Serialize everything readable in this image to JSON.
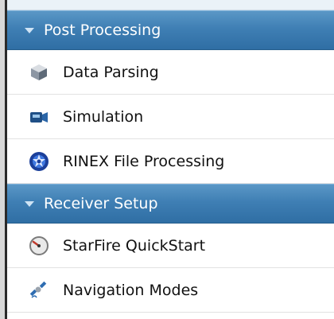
{
  "sections": [
    {
      "title": "Post Processing",
      "items": [
        {
          "label": "Data Parsing",
          "icon": "cube-icon"
        },
        {
          "label": "Simulation",
          "icon": "video-camera-icon"
        },
        {
          "label": "RINEX File Processing",
          "icon": "gear-globe-icon"
        }
      ]
    },
    {
      "title": "Receiver Setup",
      "items": [
        {
          "label": "StarFire QuickStart",
          "icon": "gauge-icon"
        },
        {
          "label": "Navigation Modes",
          "icon": "satellite-icon"
        }
      ]
    }
  ],
  "colors": {
    "header_top": "#5a97c6",
    "header_bottom": "#2f6ea4",
    "header_text": "#ffffff"
  }
}
